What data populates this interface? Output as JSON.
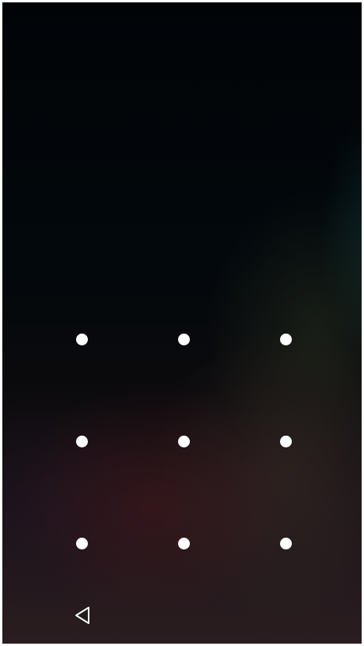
{
  "lock_screen": {
    "type": "pattern-unlock",
    "grid": {
      "rows": 3,
      "columns": 3,
      "dots": [
        {
          "id": "1"
        },
        {
          "id": "2"
        },
        {
          "id": "3"
        },
        {
          "id": "4"
        },
        {
          "id": "5"
        },
        {
          "id": "6"
        },
        {
          "id": "7"
        },
        {
          "id": "8"
        },
        {
          "id": "9"
        }
      ]
    },
    "dot_color": "#ffffff"
  },
  "nav_bar": {
    "buttons": [
      {
        "icon": "back-triangle-icon"
      }
    ],
    "icon_color": "#ffffff"
  }
}
